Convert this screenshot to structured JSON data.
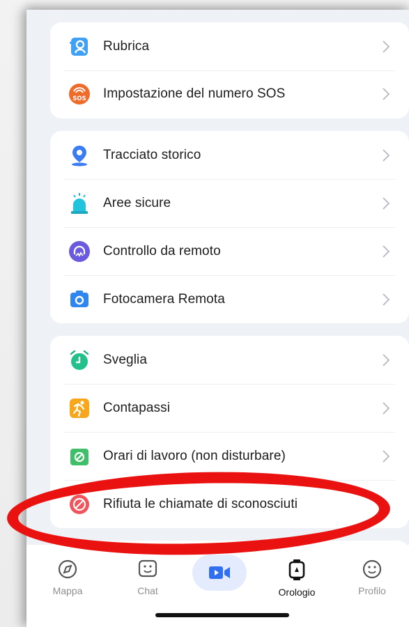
{
  "group1": {
    "items": [
      {
        "label": "Rubrica",
        "icon": "contacts-icon"
      },
      {
        "label": "Impostazione del numero SOS",
        "icon": "sos-icon"
      }
    ]
  },
  "group2": {
    "items": [
      {
        "label": "Tracciato storico",
        "icon": "location-pin-icon"
      },
      {
        "label": "Aree sicure",
        "icon": "safe-zone-icon"
      },
      {
        "label": "Controllo da remoto",
        "icon": "remote-control-icon"
      },
      {
        "label": "Fotocamera Remota",
        "icon": "camera-icon"
      }
    ]
  },
  "group3": {
    "items": [
      {
        "label": "Sveglia",
        "icon": "alarm-clock-icon"
      },
      {
        "label": "Contapassi",
        "icon": "pedometer-icon"
      },
      {
        "label": "Orari di lavoro (non disturbare)",
        "icon": "do-not-disturb-icon"
      },
      {
        "label": "Rifiuta le chiamate di sconosciuti",
        "icon": "block-call-icon"
      }
    ]
  },
  "tabbar": {
    "tabs": [
      {
        "label": "Mappa",
        "icon": "compass-icon"
      },
      {
        "label": "Chat",
        "icon": "chat-icon"
      },
      {
        "label": "",
        "icon": "video-call-icon"
      },
      {
        "label": "Orologio",
        "icon": "watch-icon",
        "active": true
      },
      {
        "label": "Profilo",
        "icon": "smile-icon"
      }
    ]
  },
  "colors": {
    "background": "#eef1f6",
    "card": "#ffffff",
    "accent": "#3b7cf5",
    "annotation": "#ea1111"
  }
}
